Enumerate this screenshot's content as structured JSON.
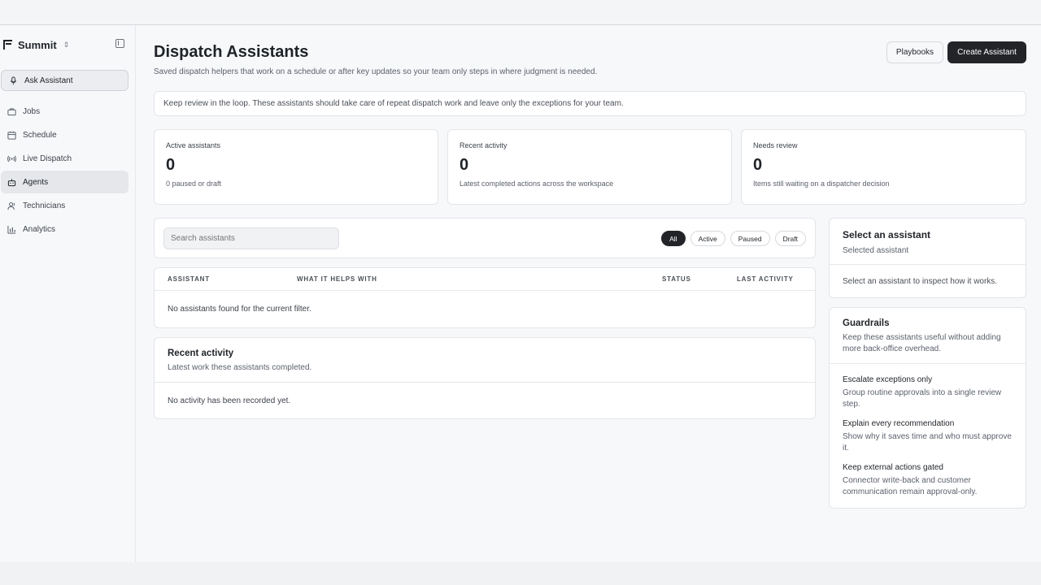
{
  "brand": {
    "name": "Summit"
  },
  "sidebar": {
    "ask_label": "Ask Assistant",
    "items": [
      {
        "label": "Jobs",
        "icon": "briefcase-icon"
      },
      {
        "label": "Schedule",
        "icon": "calendar-icon"
      },
      {
        "label": "Live Dispatch",
        "icon": "broadcast-icon"
      },
      {
        "label": "Agents",
        "icon": "bot-icon",
        "active": true
      },
      {
        "label": "Technicians",
        "icon": "users-icon"
      },
      {
        "label": "Analytics",
        "icon": "bar-chart-icon"
      }
    ]
  },
  "header": {
    "title": "Dispatch Assistants",
    "subtitle": "Saved dispatch helpers that work on a schedule or after key updates so your team only steps in where judgment is needed.",
    "playbooks_label": "Playbooks",
    "create_label": "Create Assistant"
  },
  "notice": "Keep review in the loop. These assistants should take care of repeat dispatch work and leave only the exceptions for your team.",
  "stats": [
    {
      "label": "Active assistants",
      "value": "0",
      "note": "0 paused or draft"
    },
    {
      "label": "Recent activity",
      "value": "0",
      "note": "Latest completed actions across the workspace"
    },
    {
      "label": "Needs review",
      "value": "0",
      "note": "Items still waiting on a dispatcher decision"
    }
  ],
  "filters": {
    "search_placeholder": "Search assistants",
    "chips": [
      "All",
      "Active",
      "Paused",
      "Draft"
    ],
    "selected": "All"
  },
  "table": {
    "columns": [
      "ASSISTANT",
      "WHAT IT HELPS WITH",
      "STATUS",
      "LAST ACTIVITY"
    ],
    "empty": "No assistants found for the current filter."
  },
  "activity": {
    "title": "Recent activity",
    "subtitle": "Latest work these assistants completed.",
    "empty": "No activity has been recorded yet."
  },
  "selection": {
    "title": "Select an assistant",
    "subtitle": "Selected assistant",
    "empty": "Select an assistant to inspect how it works."
  },
  "guardrails": {
    "title": "Guardrails",
    "subtitle": "Keep these assistants useful without adding more back-office overhead.",
    "items": [
      {
        "title": "Escalate exceptions only",
        "desc": "Group routine approvals into a single review step."
      },
      {
        "title": "Explain every recommendation",
        "desc": "Show why it saves time and who must approve it."
      },
      {
        "title": "Keep external actions gated",
        "desc": "Connector write-back and customer communication remain approval-only."
      }
    ]
  },
  "colors": {
    "primary": "#222428",
    "background": "#f7f8fa",
    "border": "#e3e5e8"
  }
}
